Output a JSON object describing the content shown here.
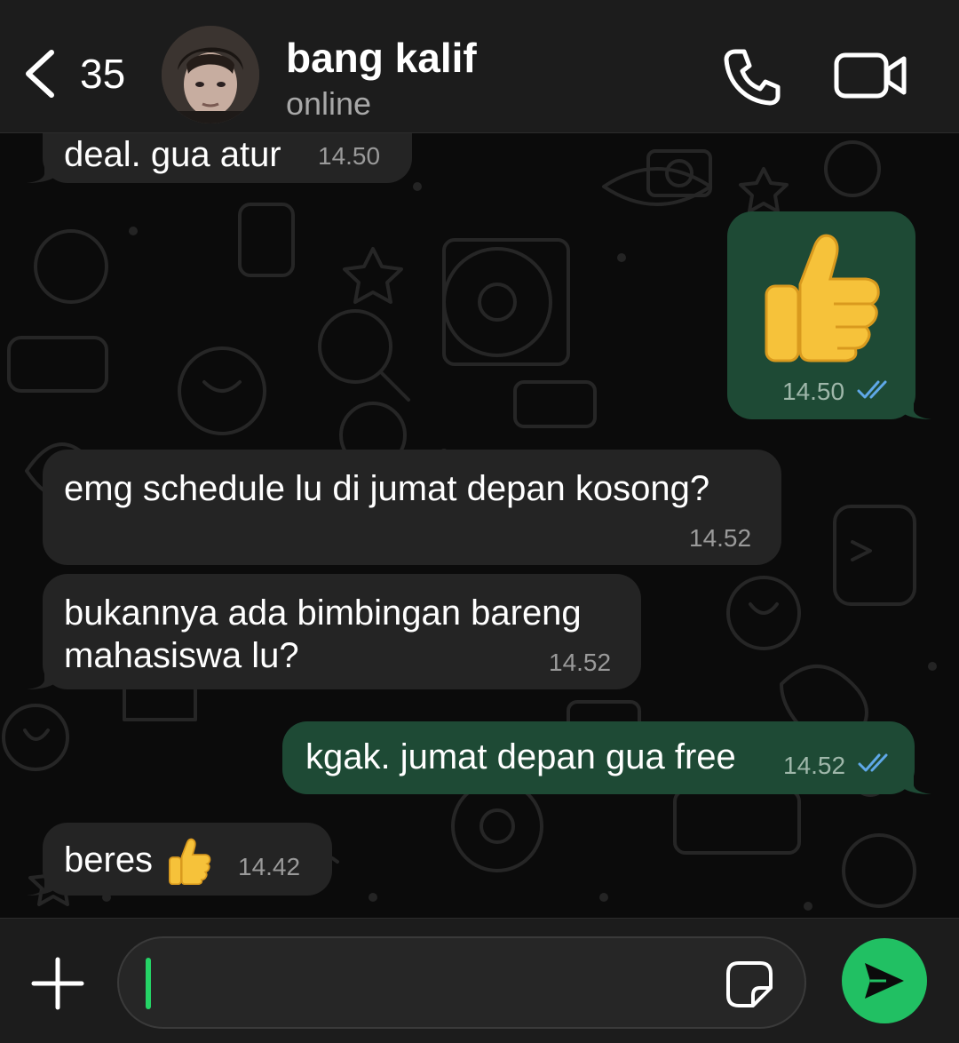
{
  "header": {
    "back_count": "35",
    "contact_name": "bang kalif",
    "contact_status": "online"
  },
  "messages": [
    {
      "direction": "incoming",
      "text": "deal. gua atur",
      "time": "14.50"
    },
    {
      "direction": "outgoing",
      "emoji": "👍",
      "time": "14.50",
      "read": true
    },
    {
      "direction": "incoming",
      "text": "emg schedule lu di jumat depan kosong?",
      "time": "14.52"
    },
    {
      "direction": "incoming",
      "text_line1": "bukannya ada bimbingan bareng",
      "text_line2": "mahasiswa lu?",
      "time": "14.52"
    },
    {
      "direction": "outgoing",
      "text": "kgak. jumat depan gua free",
      "time": "14.52",
      "read": true
    },
    {
      "direction": "incoming",
      "text": "beres",
      "emoji": "👍",
      "time": "14.42"
    }
  ],
  "input": {
    "value": "",
    "placeholder": ""
  },
  "icons": {
    "back": "chevron-left-icon",
    "call": "phone-icon",
    "video": "video-camera-icon",
    "attach": "plus-icon",
    "sticker": "sticker-icon",
    "send": "send-icon",
    "read_receipt": "double-check-icon"
  },
  "colors": {
    "incoming_bubble": "#242424",
    "outgoing_bubble": "#1e4a35",
    "accent": "#21c063",
    "read_ticks": "#5fa8e8"
  }
}
